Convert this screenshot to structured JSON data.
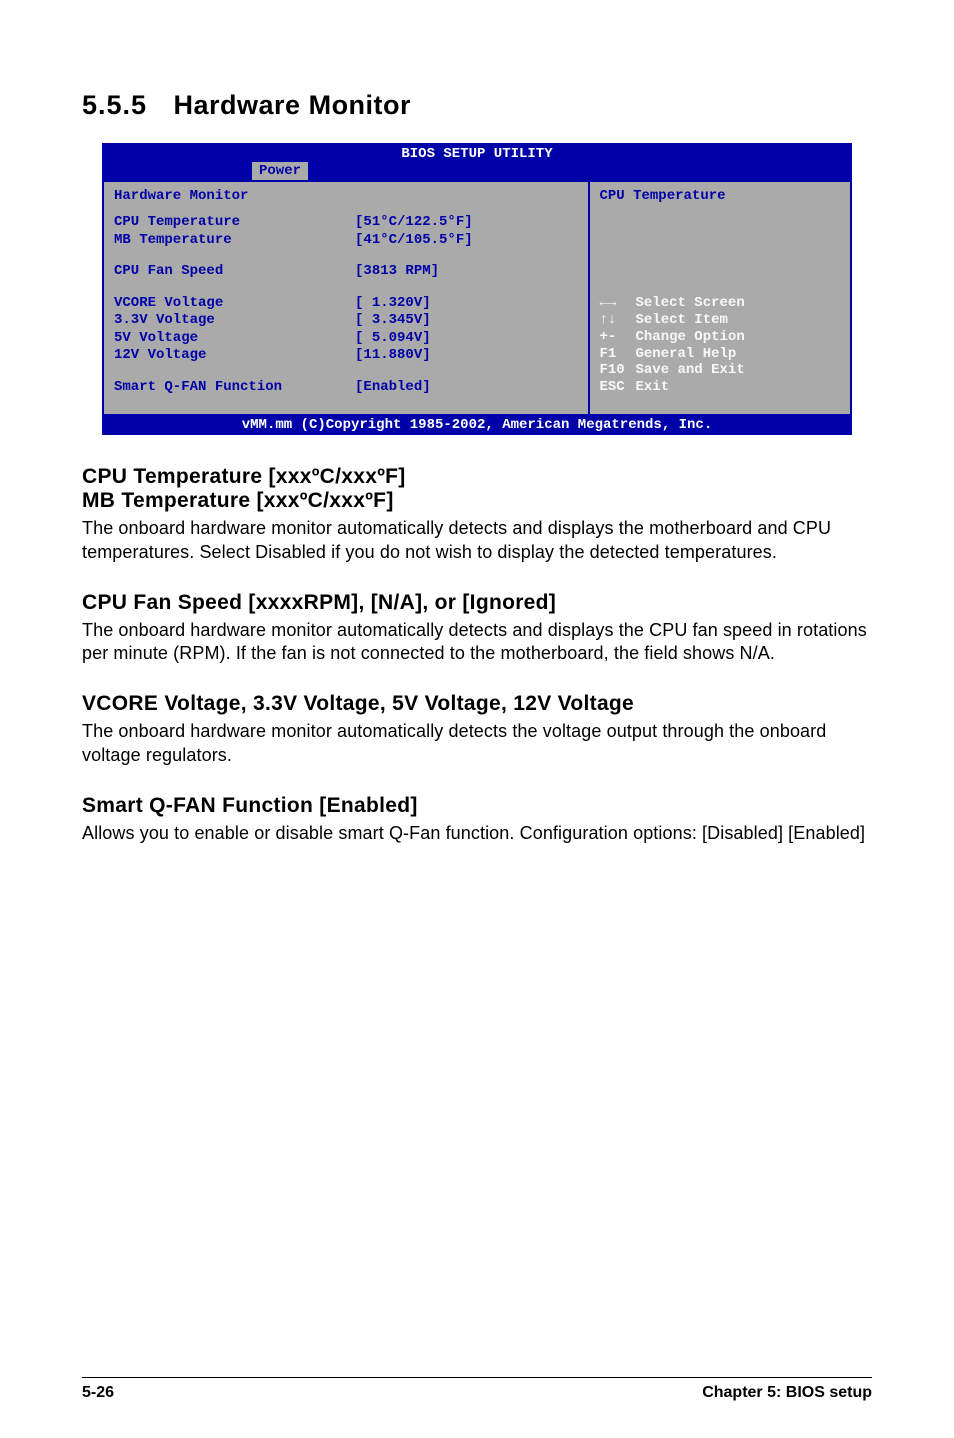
{
  "heading": {
    "number": "5.5.5",
    "title": "Hardware Monitor"
  },
  "bios": {
    "header": "BIOS SETUP UTILITY",
    "tab": "Power",
    "panel_title": "Hardware Monitor",
    "rows": [
      {
        "label": "CPU Temperature",
        "value": "[51°C/122.5°F]"
      },
      {
        "label": "MB Temperature",
        "value": "[41°C/105.5°F]"
      }
    ],
    "fan_row": {
      "label": "CPU Fan Speed",
      "value": "[3813 RPM]"
    },
    "voltage_rows": [
      {
        "label": "VCORE Voltage",
        "value": "[ 1.320V]"
      },
      {
        "label": "3.3V Voltage",
        "value": "[ 3.345V]"
      },
      {
        "label": "5V Voltage",
        "value": "[ 5.094V]"
      },
      {
        "label": "12V Voltage",
        "value": "[11.880V]"
      }
    ],
    "qfan_row": {
      "label": "Smart Q-FAN Function",
      "value": "[Enabled]"
    },
    "help_title": "CPU Temperature",
    "nav": [
      {
        "key": "←→",
        "desc": "Select Screen"
      },
      {
        "key": "↑↓",
        "desc": "Select Item"
      },
      {
        "key": "+-",
        "desc": "Change Option"
      },
      {
        "key": "F1",
        "desc": "General Help"
      },
      {
        "key": "F10",
        "desc": "Save and Exit"
      },
      {
        "key": "ESC",
        "desc": "Exit"
      }
    ],
    "footer": "vMM.mm (C)Copyright 1985-2002, American Megatrends, Inc."
  },
  "sections": [
    {
      "heading_lines": [
        "CPU Temperature [xxxºC/xxxºF]",
        "MB Temperature [xxxºC/xxxºF]"
      ],
      "body": "The onboard hardware monitor automatically detects and displays the motherboard and CPU temperatures. Select Disabled if you do not wish to display the detected temperatures."
    },
    {
      "heading_lines": [
        "CPU Fan Speed [xxxxRPM], [N/A], or [Ignored]"
      ],
      "body": "The onboard hardware monitor automatically detects and displays the CPU fan speed in rotations per minute (RPM). If the fan is not connected to the motherboard, the field shows N/A."
    },
    {
      "heading_lines": [
        "VCORE Voltage, 3.3V Voltage, 5V Voltage, 12V Voltage"
      ],
      "body": "The onboard hardware monitor automatically detects the voltage output through the onboard voltage regulators."
    },
    {
      "heading_lines": [
        "Smart Q-FAN Function [Enabled]"
      ],
      "body": "Allows you to enable or disable smart Q-Fan function. Configuration options: [Disabled] [Enabled]"
    }
  ],
  "footer": {
    "page_num": "5-26",
    "chapter": "Chapter 5: BIOS setup"
  }
}
